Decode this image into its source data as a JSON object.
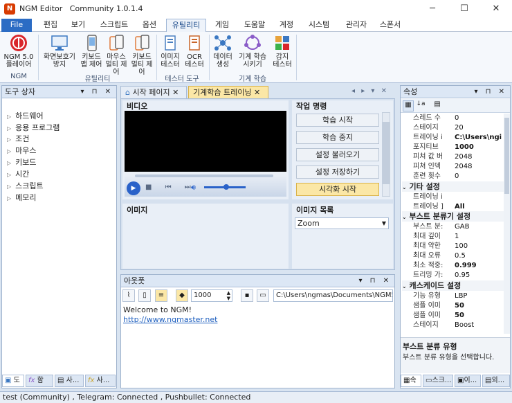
{
  "window": {
    "app_name": "NGM Editor",
    "edition": "Community 1.0.1.4",
    "minimize": "─",
    "maximize": "☐",
    "close": "✕"
  },
  "menu": {
    "file": "File",
    "tabs": [
      "편집",
      "보기",
      "스크립트",
      "옵션",
      "유틸리티",
      "게임",
      "도움말",
      "계정",
      "시스템",
      "관리자",
      "스폰서"
    ]
  },
  "ribbon": {
    "ngm": {
      "label1": "NGM 5.0",
      "label2": "플레이어",
      "group": "NGM"
    },
    "util": {
      "b1a": "화면보호기",
      "b1b": "방지",
      "b2a": "키보드",
      "b2b": "맵 제어",
      "b3a": "마우스",
      "b3b": "멀티 제어",
      "b4a": "키보드",
      "b4b": "멀티 제어",
      "group": "유틸리티"
    },
    "tester": {
      "b1a": "이미지",
      "b1b": "테스터",
      "b2a": "OCR",
      "b2b": "테스터",
      "group": "테스터 도구"
    },
    "ml": {
      "b1a": "데이터",
      "b1b": "생성",
      "b2a": "기계 학습",
      "b2b": "시키기",
      "b3a": "감지",
      "b3b": "테스터",
      "group": "기계 학습"
    }
  },
  "toolbox": {
    "title": "도구 상자",
    "items": [
      "하드웨어",
      "응용 프로그램",
      "조건",
      "마우스",
      "키보드",
      "시간",
      "스크립트",
      "메모리"
    ],
    "bottom_tabs": [
      "도",
      "함",
      "사...",
      "사..."
    ]
  },
  "docs": {
    "tab1": "시작 페이지",
    "tab2": "기계학습 트레이닝"
  },
  "video": {
    "title": "비디오"
  },
  "tasks": {
    "title": "작업 명령",
    "buttons": [
      "학습 시작",
      "학습 중지",
      "설정 불러오기",
      "설정 저장하기",
      "시각화 시작"
    ]
  },
  "image": {
    "title": "이미지"
  },
  "imagelist": {
    "title": "이미지 목록",
    "selected": "Zoom"
  },
  "output": {
    "title": "아웃풋",
    "count": "1000",
    "path": "C:\\Users\\ngmas\\Documents\\NGM5\\",
    "welcome": "Welcome to NGM!",
    "link": "http://www.ngmaster.net"
  },
  "props": {
    "title": "속성",
    "rows1": [
      [
        "스레드 수",
        "0"
      ],
      [
        "스테이지",
        "20"
      ],
      [
        "트레이닝 i",
        "C:\\Users\\ngi"
      ],
      [
        "포지티브",
        "1000"
      ],
      [
        "피쳐 값 버",
        "2048"
      ],
      [
        "피쳐 인덱",
        "2048"
      ],
      [
        "훈련 횟수",
        "0"
      ]
    ],
    "cat2": "기타 설정",
    "rows2": [
      [
        "트레이닝 i",
        ""
      ],
      [
        "트레이닝 ]",
        "All"
      ]
    ],
    "cat3": "부스트 분류기 설정",
    "rows3": [
      [
        "부스트 분:",
        "GAB"
      ],
      [
        "최대 깊이",
        "1"
      ],
      [
        "최대 약한",
        "100"
      ],
      [
        "최대 오류",
        "0.5"
      ],
      [
        "최소 적중:",
        "0.999"
      ],
      [
        "트리밍 가:",
        "0.95"
      ]
    ],
    "cat4": "캐스케이드 설정",
    "rows4": [
      [
        "기능 유형",
        "LBP"
      ],
      [
        "샘플 이미",
        "50"
      ],
      [
        "샘플 이미",
        "50"
      ],
      [
        "스테이지",
        "Boost"
      ]
    ],
    "desc_title": "부스트 분류 유형",
    "desc_text": "부스트 분류 유형을 선택합니다.",
    "bottom_tabs": [
      "속",
      "스크...",
      "이...",
      "외..."
    ]
  },
  "status": {
    "text": "test (Community)  , Telegram: Connected  , Pushbullet: Connected"
  }
}
